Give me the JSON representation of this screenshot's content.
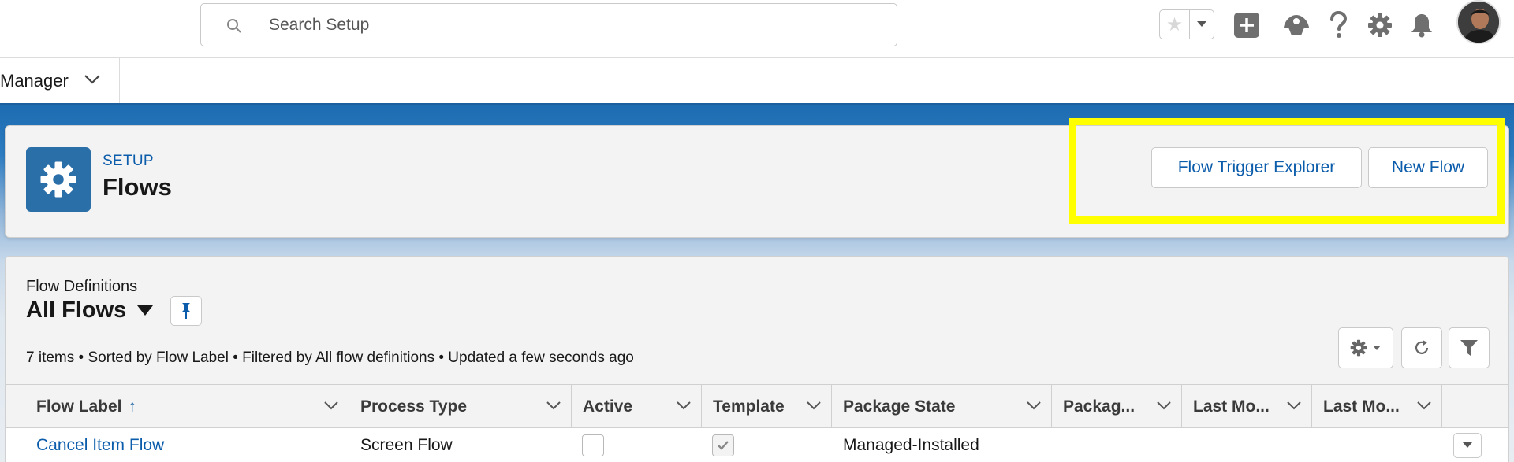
{
  "search": {
    "placeholder": "Search Setup"
  },
  "header_icons": [
    "star-icon",
    "add-icon",
    "trailhead-icon",
    "help-icon",
    "gear-icon",
    "bell-icon"
  ],
  "nav": {
    "app_label": "Manager"
  },
  "page_header": {
    "eyebrow": "SETUP",
    "title": "Flows",
    "buttons": {
      "trigger_explorer": "Flow Trigger Explorer",
      "new_flow": "New Flow"
    }
  },
  "list_view": {
    "object_label": "Flow Definitions",
    "view_name": "All Flows",
    "meta": "7 items • Sorted by Flow Label • Filtered by All flow definitions • Updated a few seconds ago"
  },
  "table": {
    "columns": [
      "Flow Label",
      "Process Type",
      "Active",
      "Template",
      "Package State",
      "Packag...",
      "Last Mo...",
      "Last Mo..."
    ],
    "sort_indicator": "↑",
    "rows": [
      {
        "flow_label": "Cancel Item Flow",
        "process_type": "Screen Flow",
        "active": false,
        "template": true,
        "package_state": "Managed-Installed"
      }
    ]
  },
  "colors": {
    "brand_blue": "#0b5cab",
    "icon_tile": "#2b6fa8",
    "highlight": "#ffff00"
  }
}
